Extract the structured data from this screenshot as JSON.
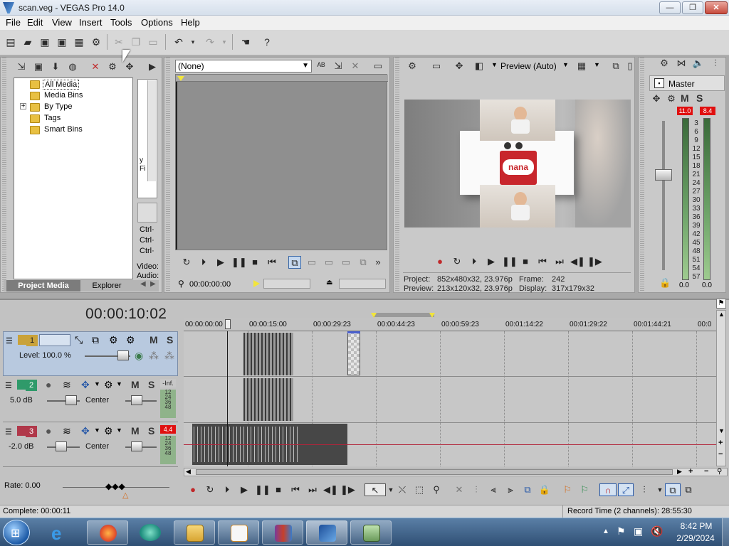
{
  "window": {
    "title": "scan.veg - VEGAS Pro 14.0",
    "btn_min": "—",
    "btn_max": "❐",
    "btn_close": "✕"
  },
  "menu": [
    "File",
    "Edit",
    "View",
    "Insert",
    "Tools",
    "Options",
    "Help"
  ],
  "project_media": {
    "tree": [
      {
        "label": "All Media",
        "selected": true
      },
      {
        "label": "Media Bins"
      },
      {
        "label": "By Type",
        "expander": "+"
      },
      {
        "label": "Tags"
      },
      {
        "label": "Smart Bins"
      }
    ],
    "side_text": [
      "y",
      "Fi",
      "Ctrl·",
      "Ctrl·",
      "Ctrl·",
      "Video:",
      "Audio:"
    ],
    "tabs": [
      "Project Media",
      "Explorer"
    ]
  },
  "trimmer": {
    "dropdown_value": "(None)",
    "timecode": "00:00:00:00"
  },
  "preview": {
    "quality": "Preview (Auto)",
    "project_label": "Project:",
    "project_value": "852x480x32, 23.976p",
    "frame_label": "Frame:",
    "frame_value": "242",
    "preview_label": "Preview:",
    "preview_value": "213x120x32, 23.976p",
    "display_label": "Display:",
    "display_value": "317x179x32",
    "product_title": "nana"
  },
  "master": {
    "label": "Master",
    "peak_left": "11.0",
    "peak_right": "8.4",
    "scale": [
      "3",
      "6",
      "9",
      "12",
      "15",
      "18",
      "21",
      "24",
      "27",
      "30",
      "33",
      "36",
      "39",
      "42",
      "45",
      "48",
      "51",
      "54",
      "57"
    ],
    "bottom_left": "0.0",
    "bottom_right": "0.0",
    "mute": "M",
    "solo": "S"
  },
  "timeline": {
    "cursor_time": "00:00:10:02",
    "ruler": [
      "00:00:00:00",
      "00:00:15:00",
      "00:00:29:23",
      "00:00:44:23",
      "00:00:59:23",
      "00:01:14:22",
      "00:01:29:22",
      "00:01:44:21",
      "00:0"
    ],
    "tracks": [
      {
        "num": "1",
        "kind": "video",
        "level": "Level: 100.0 %",
        "color": "#c9a23a"
      },
      {
        "num": "2",
        "kind": "audio",
        "volume": "5.0 dB",
        "pan": "Center",
        "peak": "-Inf.",
        "color": "#2f9a6a"
      },
      {
        "num": "3",
        "kind": "audio",
        "volume": "-2.0 dB",
        "pan": "Center",
        "peak": "4.4",
        "color": "#b0384a"
      }
    ],
    "mini_scale": [
      "12",
      "24",
      "36",
      "48"
    ],
    "mute": "M",
    "solo": "S"
  },
  "bottom": {
    "rate": "Rate: 0.00"
  },
  "status": {
    "left": "Complete: 00:00:11",
    "right": "Record Time (2 channels): 28:55:30"
  },
  "taskbar": {
    "time": "8:42 PM",
    "date": "2/29/2024"
  },
  "colors": {
    "accent_video": "#c9a23a",
    "accent_audio2": "#2f9a6a",
    "accent_audio3": "#b0384a",
    "peak_red": "#e01010"
  }
}
